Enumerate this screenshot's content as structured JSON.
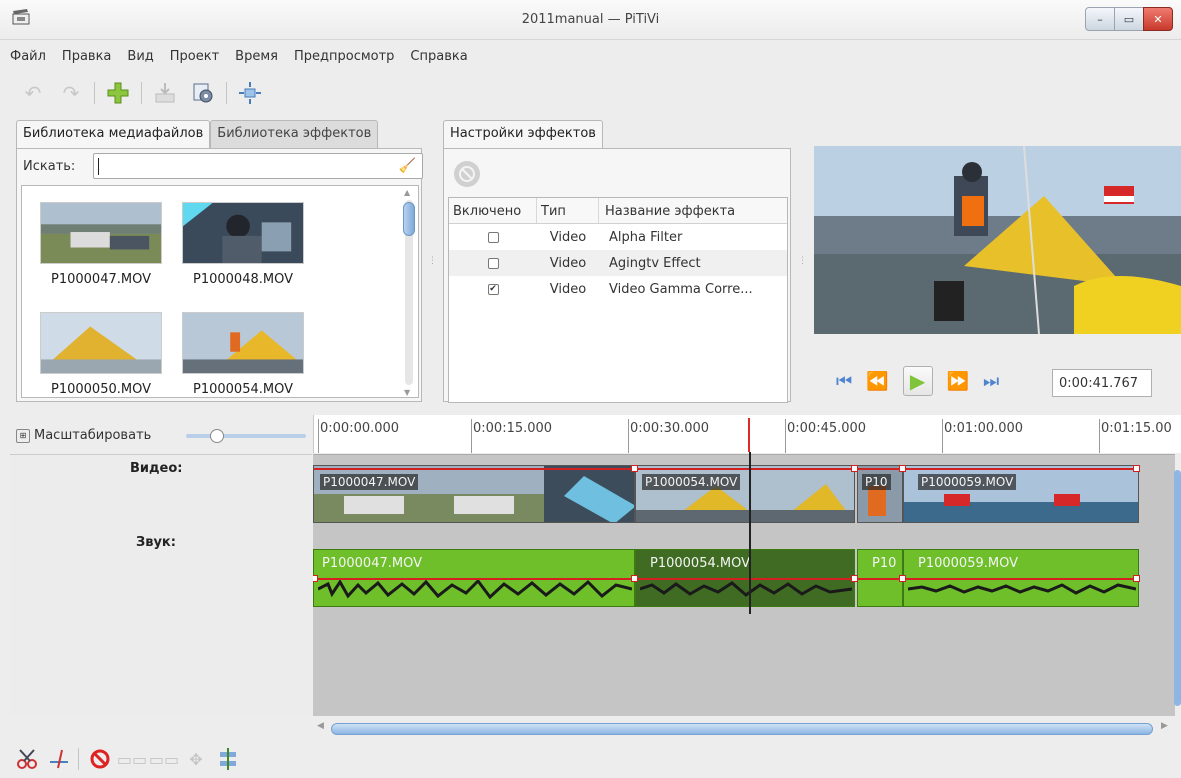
{
  "window": {
    "title": "2011manual — PiTiVi",
    "app_icon": "clapperboard-icon"
  },
  "menu": [
    "Файл",
    "Правка",
    "Вид",
    "Проект",
    "Время",
    "Предпросмотр",
    "Справка"
  ],
  "toolbar": {
    "icons": [
      "undo-icon",
      "redo-icon",
      "add-icon",
      "render-icon",
      "project-settings-icon",
      "fullscreen-icon"
    ]
  },
  "library": {
    "tabs": [
      "Библиотека медиафайлов",
      "Библиотека эффектов"
    ],
    "search_label": "Искать:",
    "search_value": "",
    "clips": [
      "P1000047.MOV",
      "P1000048.MOV",
      "P1000050.MOV",
      "P1000054.MOV"
    ]
  },
  "effects": {
    "tab": "Настройки эффектов",
    "columns": [
      "Включено",
      "Тип",
      "Название эффекта"
    ],
    "rows": [
      {
        "enabled": false,
        "type": "Video",
        "name": "Alpha Filter"
      },
      {
        "enabled": false,
        "type": "Video",
        "name": "Agingtv Effect"
      },
      {
        "enabled": true,
        "type": "Video",
        "name": "Video Gamma Corre..."
      }
    ]
  },
  "viewer": {
    "timecode": "0:00:41.767"
  },
  "timeline": {
    "zoom_label": "Масштабировать",
    "zoom_level": 0.2,
    "ruler": [
      "0:00:00.000",
      "0:00:15.000",
      "0:00:30.000",
      "0:00:45.000",
      "0:01:00.000",
      "0:01:15.00"
    ],
    "tracks": {
      "video": "Видео:",
      "audio": "Звук:"
    },
    "video_clips": [
      "P1000047.MOV",
      "P1000054.MOV",
      "P10",
      "P1000059.MOV"
    ],
    "audio_clips": [
      "P1000047.MOV",
      "P1000054.MOV",
      "P10",
      "P1000059.MOV"
    ]
  },
  "colors": {
    "accent": "#7ea9d8",
    "audio_clip": "#6ebf2a",
    "audio_clip_selected": "#3f6c22",
    "keyframe_line": "#d42020"
  }
}
